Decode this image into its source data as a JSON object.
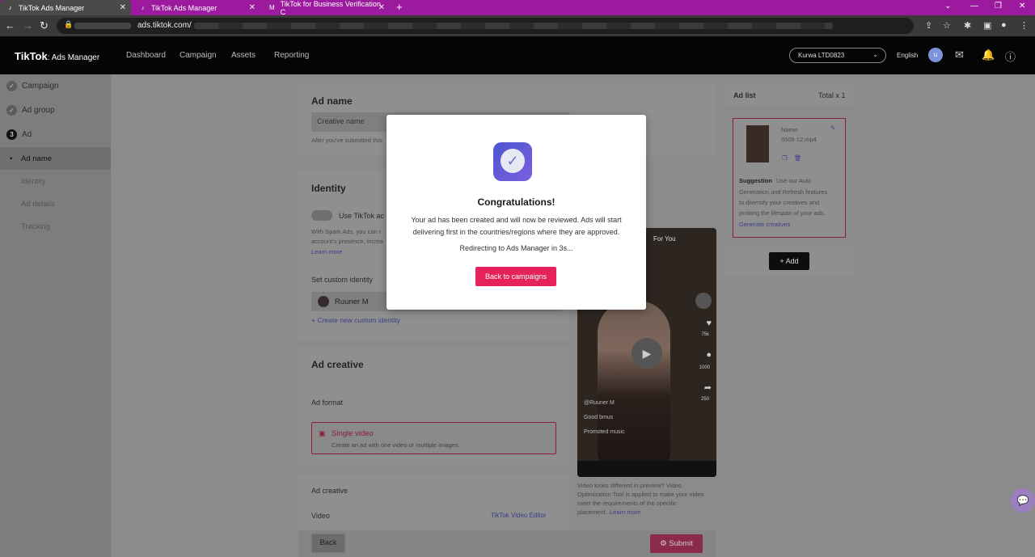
{
  "browser": {
    "tabs": [
      {
        "title": "TikTok Ads Manager"
      },
      {
        "title": "TikTok Ads Manager"
      },
      {
        "title": "TikTok for Business Verification C"
      }
    ],
    "new_tab_label": "+",
    "url": "ads.tiktok.com/"
  },
  "header": {
    "logo_main": "TikTok",
    "logo_sub": ": Ads Manager",
    "nav": [
      "Dashboard",
      "Campaign",
      "Assets",
      "Reporting"
    ],
    "account": "Kurwa LTD0823",
    "language": "English",
    "avatar_initial": "u"
  },
  "sidebar": {
    "steps": [
      "Campaign",
      "Ad group",
      "Ad"
    ],
    "ad_step_number": "3",
    "substeps": [
      "Ad name",
      "Identity",
      "Ad details",
      "Tracking"
    ]
  },
  "form": {
    "ad_name_title": "Ad name",
    "creative_name_chip": "Creative name",
    "ad_name_hint": "After you've submitted this",
    "identity_title": "Identity",
    "use_tiktok_label": "Use TikTok ac",
    "spark_ads_text_1": "With Spark Ads, you can r",
    "spark_ads_text_2": "account's presence, increa",
    "learn_more": "Learn more",
    "set_custom_identity": "Set custom identity",
    "identity_value": "Ruuner M",
    "create_identity": "+ Create new custom identity",
    "ad_creative_title": "Ad creative",
    "ad_format_label": "Ad format",
    "format_name": "Single video",
    "format_desc": "Create an ad with one video or multiple images.",
    "ad_creative_sub": "Ad creative",
    "video_label": "Video",
    "video_editor": "TikTok Video Editor"
  },
  "preview": {
    "for_you": "For You",
    "username": "@Ruuner M",
    "caption": "Good bmus",
    "music": "Promoted music",
    "likes": "75k",
    "comments": "1000",
    "shares": "250",
    "note_1": "Video looks different in preview? Video",
    "note_2": "Optimization Tool is applied to make your video",
    "note_3": "meet the requirements of the specific",
    "note_4": "placement.",
    "note_link": "Learn more"
  },
  "adlist": {
    "title": "Ad list",
    "total": "Total x 1",
    "name_label": "Name",
    "file_name": "0509 12.mp4",
    "suggestion_label": "Suggestion",
    "suggestion_1": "Use our Auto",
    "suggestion_2": "Generation and Refresh features",
    "suggestion_3": "to diversify your creatives and",
    "suggestion_4": "prolong the lifespan of your ads.",
    "generate_link": "Generate creatives",
    "add_button": "+ Add"
  },
  "footer": {
    "back": "Back",
    "submit": "Submit"
  },
  "modal": {
    "title": "Congratulations!",
    "body": "Your ad has been created and will now be reviewed. Ads will start delivering first in the countries/regions where they are approved.",
    "redirect": "Redirecting to Ads Manager in 3s...",
    "button": "Back to campaigns"
  },
  "colors": {
    "tab_bar": "#9c1a9e",
    "primary_button": "#e6225a",
    "modal_bg": "#ffffff"
  }
}
